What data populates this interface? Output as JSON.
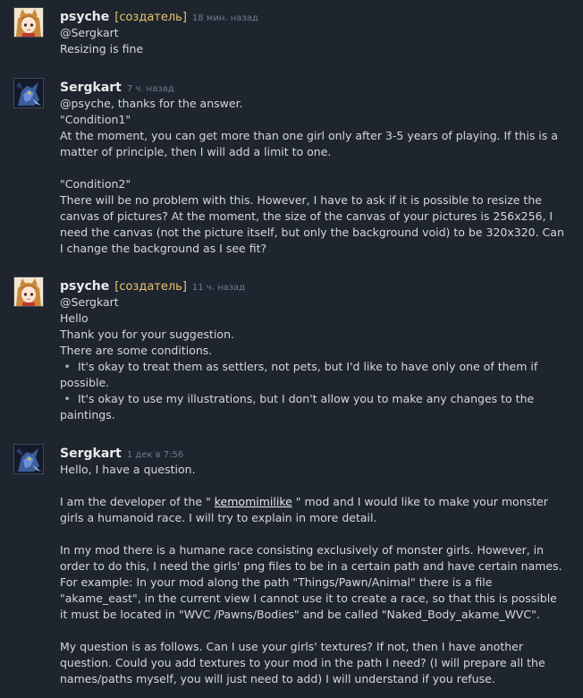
{
  "thread": {
    "creator_badge": "[создатель]",
    "comments": [
      {
        "author": "psyche",
        "is_creator": true,
        "time": "18 мин. назад",
        "avatar": "anime-girl-avatar",
        "lines": [
          "@Sergkart",
          "Resizing is fine"
        ]
      },
      {
        "author": "Sergkart",
        "is_creator": false,
        "time": "7 ч. назад",
        "avatar": "blue-monster-avatar",
        "lines": [
          "@psyche, thanks for the answer.",
          "\"Condition1\"",
          "At the moment, you can get more than one girl only after 3-5 years of playing. If this is a",
          "matter of principle, then I will add a limit to one.",
          "",
          "\"Condition2\"",
          "There will be no problem with this. However, I have to ask if it is possible to resize the",
          "canvas of pictures? At the moment, the size of the canvas of your pictures is 256x256, I",
          "need the canvas (not the picture itself, but only the background void) to be 320x320. Can",
          "I change the background as I see fit?"
        ]
      },
      {
        "author": "psyche",
        "is_creator": true,
        "time": "11 ч. назад",
        "avatar": "anime-girl-avatar",
        "lines": [
          "@Sergkart",
          "Hello",
          "Thank you for your suggestion.",
          "There are some conditions.",
          "• It's okay to treat them as settlers, not pets, but I'd like to have only one of them if",
          "possible.",
          "• It's okay to use my illustrations, but I don't allow you to make any changes to the",
          "paintings."
        ]
      },
      {
        "author": "Sergkart",
        "is_creator": false,
        "time": "1 дек в 7:56",
        "avatar": "blue-monster-avatar",
        "lines": [
          "Hello, I have a question.",
          "",
          "I am the developer of the \" kemomimilike \" mod and I would like to make your monster",
          "girls a humanoid race. I will try to explain in more detail.",
          "",
          "In my mod there is a humane race consisting exclusively of monster girls. However, in",
          "order to do this, I need the girls' png files to be in a certain path and have certain names.",
          "For example: In your mod along the path \"Things/Pawn/Animal\" there is a file",
          "\"akame_east\", in the current view I cannot use it to create a race, so that this is possible",
          "it must be located in \"WVC /Pawns/Bodies\" and be called \"Naked_Body_akame_WVC\".",
          "",
          "My question is as follows. Can I use your girls' textures? If not, then I have another",
          "question. Could you add textures to your mod in the path I need? (I will prepare all the",
          "names/paths myself, you will just need to add) I will understand if you refuse."
        ],
        "link_text": "kemomimilike"
      }
    ]
  },
  "colors": {
    "background": "#1e252e",
    "text": "#d6d7d8",
    "author": "#ebebeb",
    "creator_badge": "#e9c46f",
    "timestamp": "#6d7d8e"
  }
}
